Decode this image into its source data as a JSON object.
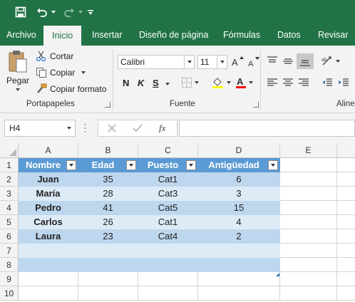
{
  "ribbon_tabs": [
    "Archivo",
    "Inicio",
    "Insertar",
    "Diseño de página",
    "Fórmulas",
    "Datos",
    "Revisar"
  ],
  "clipboard": {
    "paste_label": "Pegar",
    "cut_label": "Cortar",
    "copy_label": "Copiar",
    "format_painter_label": "Copiar formato",
    "group_label": "Portapapeles"
  },
  "font": {
    "family": "Calibri",
    "size": "11",
    "bold": "N",
    "italic": "K",
    "underline": "S",
    "group_label": "Fuente",
    "highlight_color": "#ffff00",
    "font_color": "#ff0000"
  },
  "alignment": {
    "group_label": "Aline"
  },
  "formula_bar": {
    "name_box": "H4",
    "fx": "fx",
    "formula": ""
  },
  "sheet": {
    "columns": [
      "A",
      "B",
      "C",
      "D",
      "E"
    ],
    "rows": [
      "1",
      "2",
      "3",
      "4",
      "5",
      "6",
      "7",
      "8",
      "9",
      "10"
    ],
    "table_headers": [
      "Nombre",
      "Edad",
      "Puesto",
      "Antigüedad"
    ],
    "table_rows": [
      [
        "Juan",
        "35",
        "Cat1",
        "6"
      ],
      [
        "María",
        "28",
        "Cat3",
        "3"
      ],
      [
        "Pedro",
        "41",
        "Cat5",
        "15"
      ],
      [
        "Carlos",
        "26",
        "Cat1",
        "4"
      ],
      [
        "Laura",
        "23",
        "Cat4",
        "2"
      ]
    ]
  },
  "colors": {
    "excel_green": "#217346",
    "table_header": "#5b9bd5",
    "table_band_light": "#ddebf7",
    "table_band_dark": "#bdd7ee"
  }
}
